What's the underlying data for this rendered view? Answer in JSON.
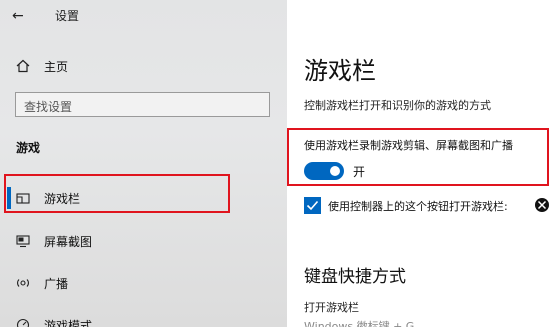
{
  "window": {
    "back_glyph": "←",
    "title": "设置"
  },
  "sidebar": {
    "home_label": "主页",
    "search_placeholder": "查找设置",
    "section_label": "游戏",
    "items": [
      {
        "label": "游戏栏",
        "icon": "game-bar-icon",
        "active": true
      },
      {
        "label": "屏幕截图",
        "icon": "screen-capture-icon"
      },
      {
        "label": "广播",
        "icon": "broadcast-icon"
      },
      {
        "label": "游戏模式",
        "icon": "game-mode-icon"
      }
    ]
  },
  "main": {
    "title": "游戏栏",
    "description": "控制游戏栏打开和识别你的游戏的方式",
    "toggle_caption": "使用游戏栏录制游戏剪辑、屏幕截图和广播",
    "toggle_state": "开",
    "checkbox_label": "使用控制器上的这个按钮打开游戏栏:",
    "keyboard_heading": "键盘快捷方式",
    "shortcut_label": "打开游戏栏",
    "faded_text": "Windows 徽标键 + G"
  },
  "colors": {
    "accent": "#0067c0",
    "highlight": "#e0141e",
    "sidebar_bg": "#e4e5e6"
  }
}
